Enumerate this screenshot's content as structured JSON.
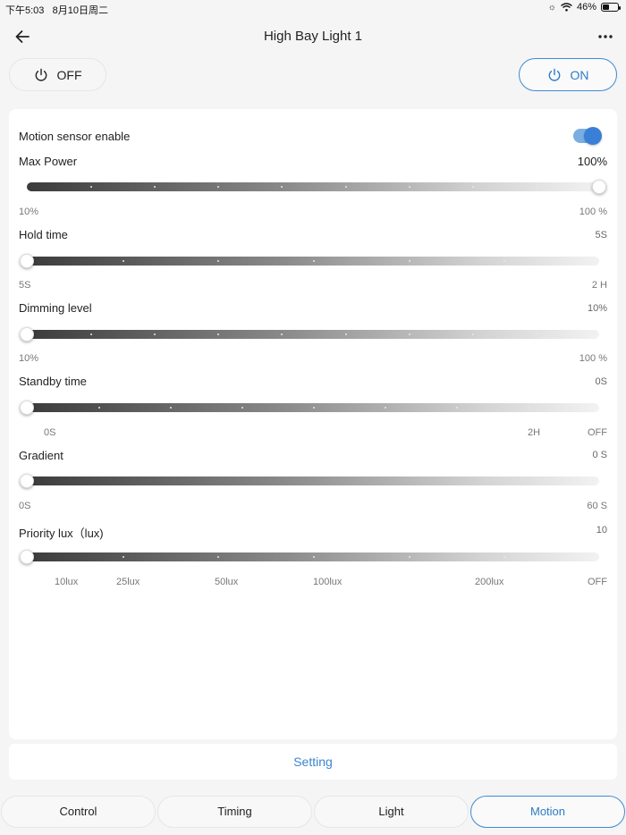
{
  "status": {
    "time": "下午5:03",
    "date": "8月10日周二",
    "battery_percent": "46%",
    "battery_level": 0.46
  },
  "header": {
    "title": "High Bay Light 1",
    "back_icon": "arrow-left-icon",
    "more_icon": "more-horizontal-icon"
  },
  "power": {
    "off_label": "OFF",
    "on_label": "ON",
    "icon": "power-icon"
  },
  "colors": {
    "accent": "#3a7fd6",
    "toggle_track": "#7aaee3",
    "text": "#222222"
  },
  "motion_sensor": {
    "label": "Motion sensor enable",
    "enabled": true
  },
  "sliders": {
    "max_power": {
      "label": "Max Power",
      "value": "100%",
      "level": 1.0,
      "min_label": "10%",
      "max_label": "100 %"
    },
    "hold_time": {
      "label": "Hold time",
      "value": "5S",
      "level": 0.0,
      "min_label": "5S",
      "max_label": "2 H"
    },
    "dimming_level": {
      "label": "Dimming level",
      "value": "10%",
      "level": 0.0,
      "min_label": "10%",
      "max_label": "100 %"
    },
    "standby_time": {
      "label": "Standby time",
      "value": "0S",
      "level": 0.0,
      "ticks": [
        "0S",
        "2H",
        "OFF"
      ]
    },
    "gradient": {
      "label": "Gradient",
      "value": "0 S",
      "level": 0.0,
      "min_label": "0S",
      "max_label": "60 S"
    },
    "priority_lux": {
      "label": "Priority lux（lux)",
      "value": "10",
      "level": 0.0,
      "ticks": [
        "10lux",
        "25lux",
        "50lux",
        "100lux",
        "200lux",
        "OFF"
      ]
    }
  },
  "setting_label": "Setting",
  "tabs": [
    {
      "label": "Control",
      "active": false
    },
    {
      "label": "Timing",
      "active": false
    },
    {
      "label": "Light",
      "active": false
    },
    {
      "label": "Motion",
      "active": true
    }
  ]
}
